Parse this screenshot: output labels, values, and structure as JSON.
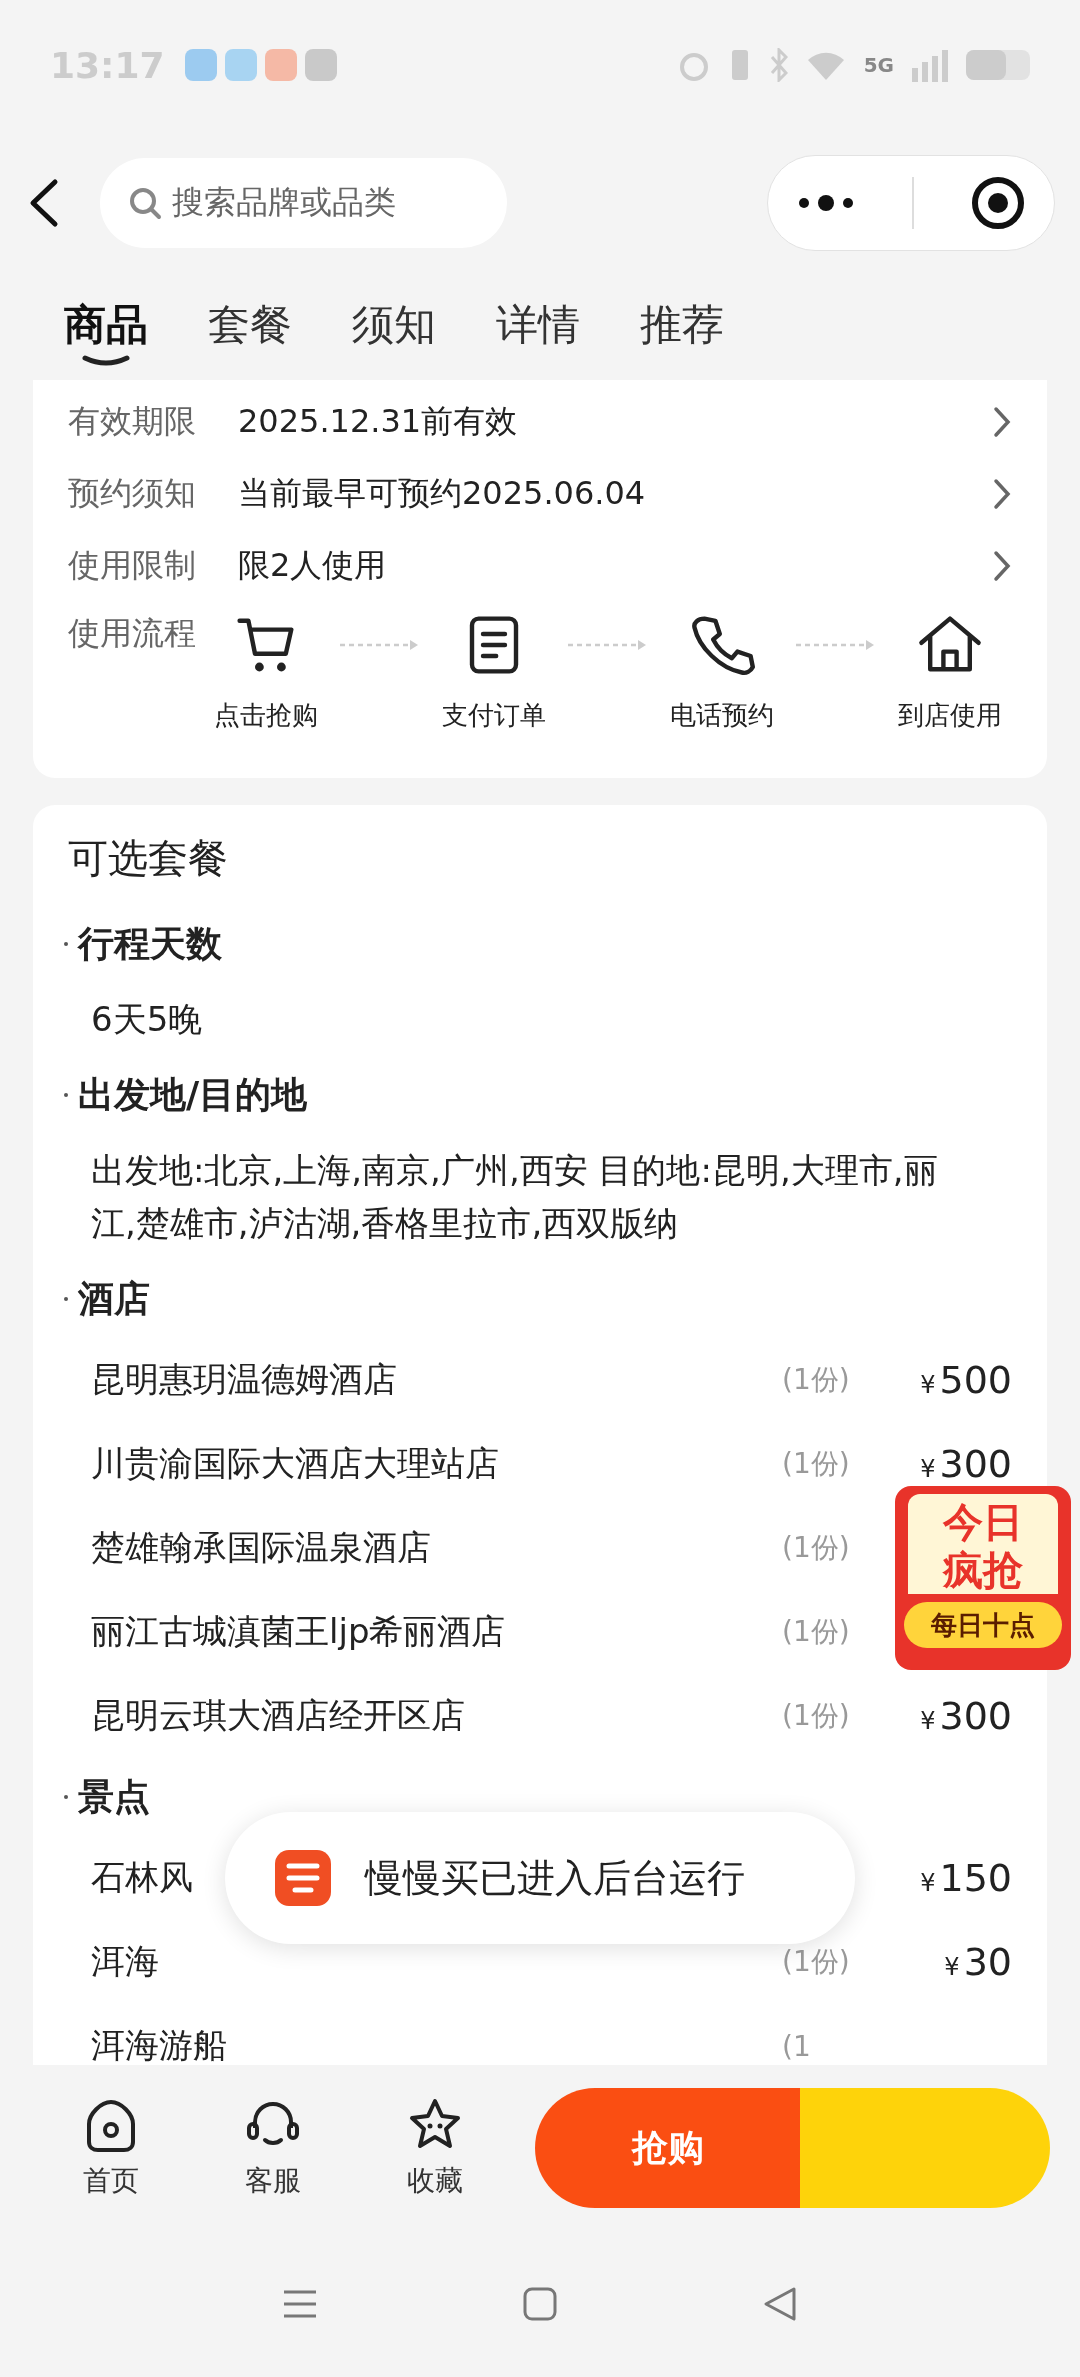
{
  "status_bar": {
    "time": "13:17",
    "network": "5G"
  },
  "header": {
    "search": {
      "placeholder": "搜索品牌或品类"
    }
  },
  "tabs": [
    {
      "label": "商品",
      "selected": true
    },
    {
      "label": "套餐",
      "selected": false
    },
    {
      "label": "须知",
      "selected": false
    },
    {
      "label": "详情",
      "selected": false
    },
    {
      "label": "推荐",
      "selected": false
    }
  ],
  "info_rows": [
    {
      "label": "有效期限",
      "value": "2025.12.31前有效"
    },
    {
      "label": "预约须知",
      "value": "当前最早可预约2025.06.04"
    },
    {
      "label": "使用限制",
      "value": "限2人使用"
    }
  ],
  "usage_flow": {
    "label": "使用流程",
    "steps": [
      {
        "kind": "cart",
        "label": "点击抢购"
      },
      {
        "kind": "order",
        "label": "支付订单"
      },
      {
        "kind": "phone",
        "label": "电话预约"
      },
      {
        "kind": "store",
        "label": "到店使用"
      }
    ]
  },
  "package": {
    "title": "可选套餐",
    "sections": [
      {
        "heading": "行程天数",
        "kind": "text",
        "text": "6天5晚"
      },
      {
        "heading": "出发地/目的地",
        "kind": "text",
        "text": "出发地:北京,上海,南京,广州,西安 目的地:昆明,大理市,丽江,楚雄市,泸沽湖,香格里拉市,西双版纳"
      },
      {
        "heading": "酒店",
        "kind": "items",
        "items": [
          {
            "name": "昆明惠玥温德姆酒店",
            "quantity": "(1份)",
            "currency": "¥",
            "amount": "500"
          },
          {
            "name": "川贵渝国际大酒店大理站店",
            "quantity": "(1份)",
            "currency": "¥",
            "amount": "300"
          },
          {
            "name": "楚雄翰承国际温泉酒店",
            "quantity": "(1份)"
          },
          {
            "name": "丽江古城滇菌王ljp希丽酒店",
            "quantity": "(1份)"
          },
          {
            "name": "昆明云琪大酒店经开区店",
            "quantity": "(1份)",
            "currency": "¥",
            "amount": "300"
          }
        ]
      },
      {
        "heading": "景点",
        "kind": "items",
        "items": [
          {
            "name": "石林风",
            "currency": "¥",
            "amount": "150"
          },
          {
            "name": "洱海",
            "quantity": "(1份)",
            "currency": "¥",
            "amount": "30"
          },
          {
            "name": "洱海游船",
            "quantity": "(1"
          }
        ]
      }
    ]
  },
  "promo_badge": {
    "line_1": "今日",
    "line_2": "疯抢",
    "line_3": "每日十点"
  },
  "toast": {
    "text": "慢慢买已进入后台运行"
  },
  "bottom_bar": {
    "items": [
      {
        "kind": "home",
        "label": "首页"
      },
      {
        "kind": "service",
        "label": "客服"
      },
      {
        "kind": "favorite",
        "label": "收藏"
      }
    ],
    "buy_button": "抢购"
  }
}
